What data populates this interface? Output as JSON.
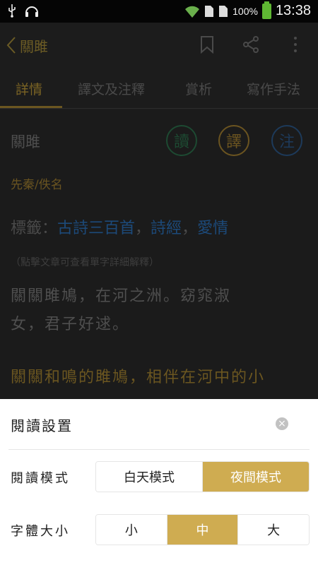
{
  "status_bar": {
    "battery_percent": "100%",
    "time": "13:38"
  },
  "app_bar": {
    "title": "關雎"
  },
  "tabs": [
    {
      "label": "詳情",
      "active": true
    },
    {
      "label": "譯文及注釋",
      "active": false
    },
    {
      "label": "賞析",
      "active": false
    },
    {
      "label": "寫作手法",
      "active": false
    }
  ],
  "poem": {
    "title": "關雎",
    "actions": {
      "read": "讀",
      "translate": "譯",
      "note": "注"
    },
    "author": "先秦/佚名",
    "tags_label": "標籤：",
    "tags": [
      "古詩三百首",
      "詩經",
      "愛情"
    ],
    "tag_separator": "，",
    "hint": "（點擊文章可查看單字詳細解釋）",
    "text_line1": "關關雎鳩，在河之洲。窈窕淑",
    "text_line2": "女，君子好逑。",
    "translation": "關關和鳴的雎鳩，相伴在河中的小"
  },
  "settings": {
    "title": "閱讀設置",
    "close_icon": "close-icon",
    "mode_label": "閱讀模式",
    "mode_options": [
      "白天模式",
      "夜間模式"
    ],
    "mode_selected": "夜間模式",
    "size_label": "字體大小",
    "size_options": [
      "小",
      "中",
      "大"
    ],
    "size_selected": "中"
  },
  "colors": {
    "accent": "#cfac51",
    "link": "#1c4a7a",
    "background_dim": "#1b1b1b"
  }
}
